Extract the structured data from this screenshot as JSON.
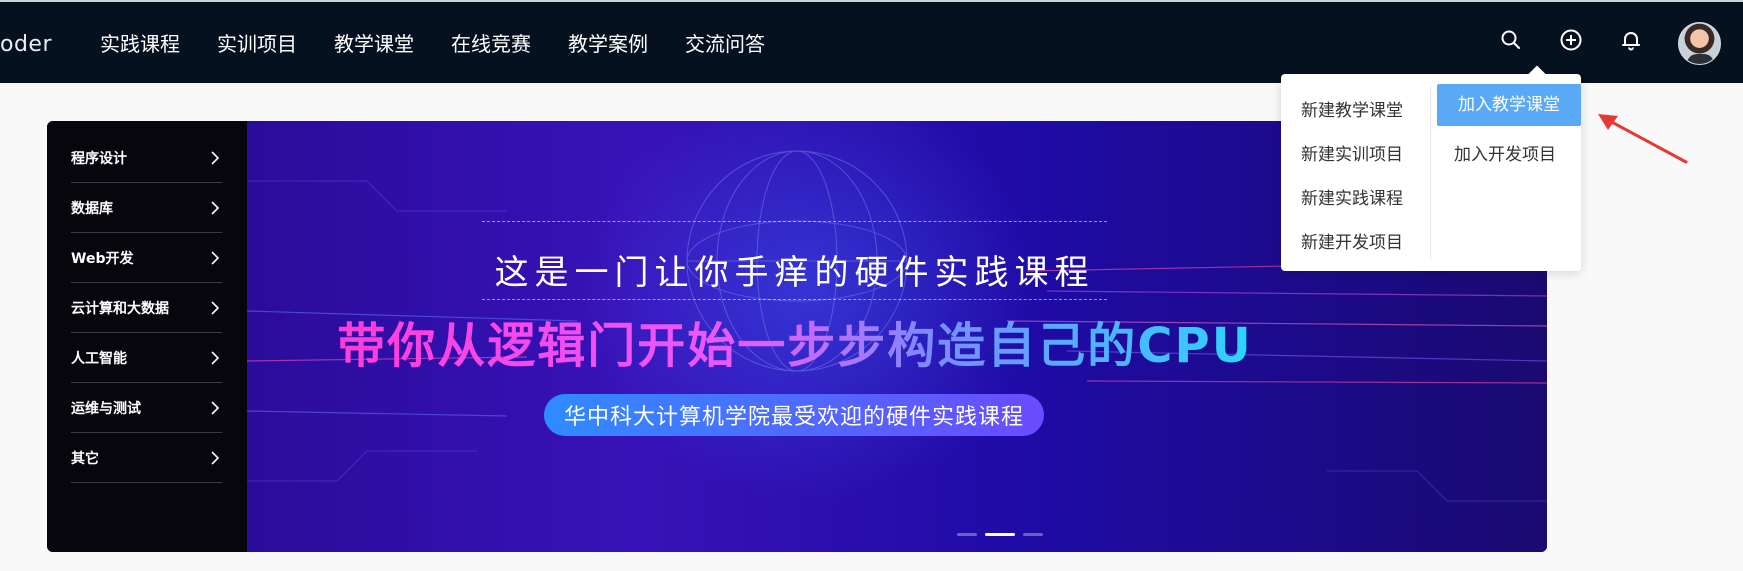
{
  "header": {
    "logo_text": "oder",
    "nav": [
      "实践课程",
      "实训项目",
      "教学课堂",
      "在线竞赛",
      "教学案例",
      "交流问答"
    ],
    "icons": [
      "search-icon",
      "add-circle-icon",
      "bell-icon"
    ]
  },
  "dropdown": {
    "left_items": [
      "新建教学课堂",
      "新建实训项目",
      "新建实践课程",
      "新建开发项目"
    ],
    "right_items": [
      "加入教学课堂",
      "加入开发项目"
    ],
    "active_item": "加入教学课堂",
    "active_color": "#5aa9f5"
  },
  "sidebar": {
    "items": [
      "程序设计",
      "数据库",
      "Web开发",
      "云计算和大数据",
      "人工智能",
      "运维与测试",
      "其它"
    ]
  },
  "banner": {
    "line1": "这是一门让你手痒的硬件实践课程",
    "line2": "带你从逻辑门开始一步步构造自己的CPU",
    "line3": "华中科大计算机学院最受欢迎的硬件实践课程",
    "slide_count": 3,
    "active_slide": 2
  },
  "colors": {
    "header_bg": "#05111f",
    "annotation_arrow": "#e53935"
  }
}
